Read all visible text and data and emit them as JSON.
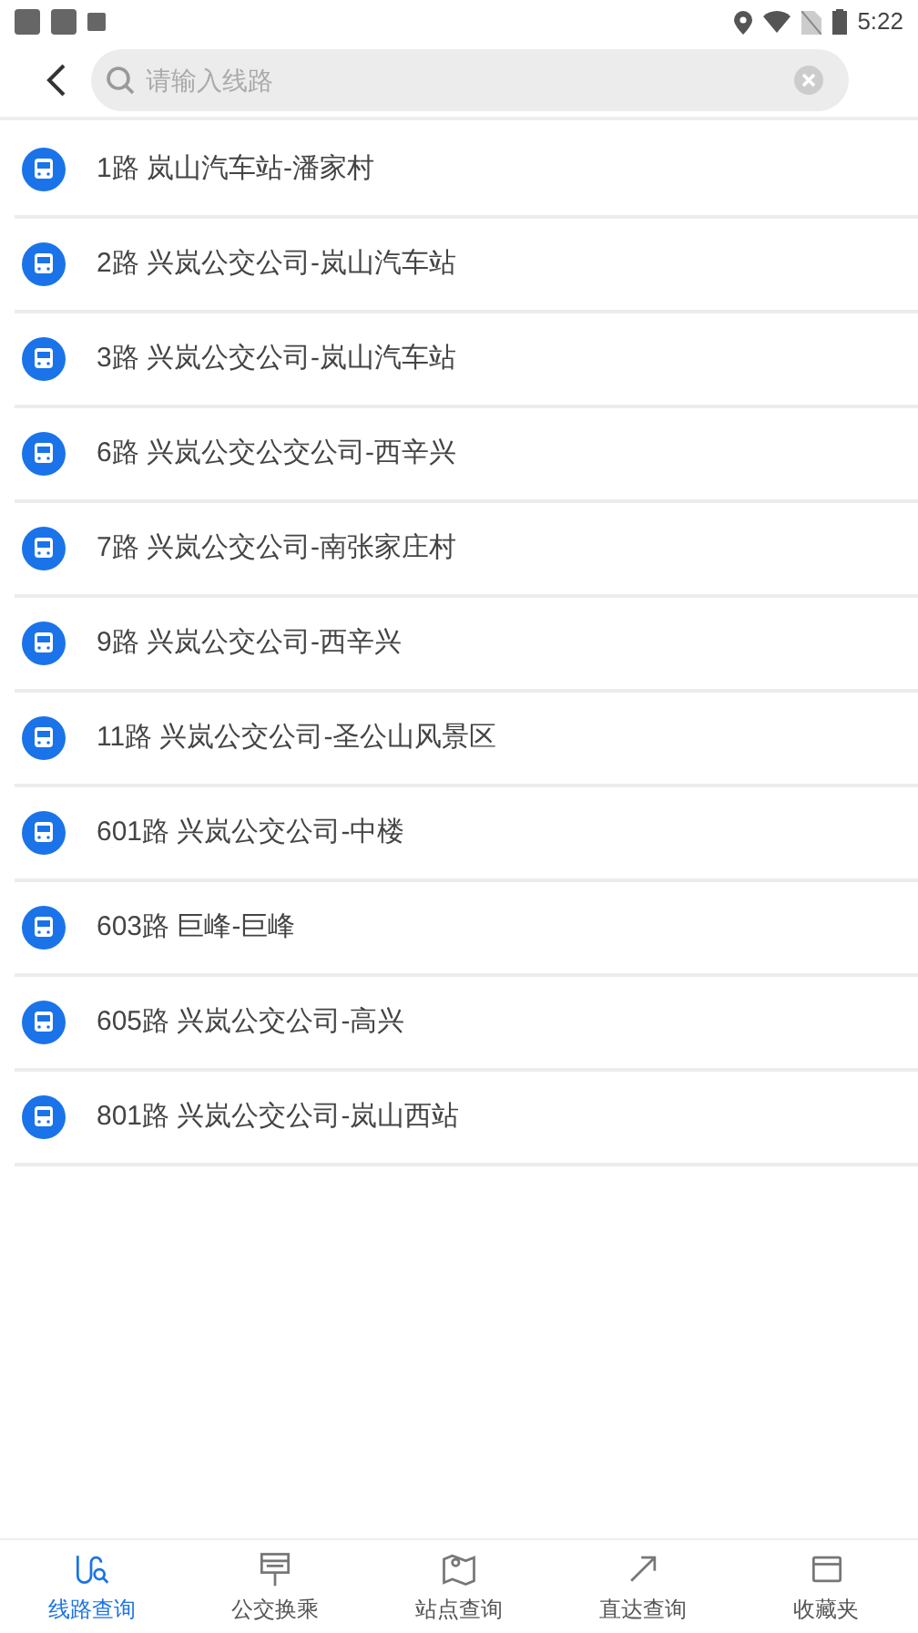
{
  "status_bar": {
    "time": "5:22"
  },
  "search": {
    "placeholder": "请输入线路"
  },
  "routes": [
    {
      "label": "1路 岚山汽车站-潘家村"
    },
    {
      "label": "2路 兴岚公交公司-岚山汽车站"
    },
    {
      "label": "3路 兴岚公交公司-岚山汽车站"
    },
    {
      "label": "6路 兴岚公交公交公司-西辛兴"
    },
    {
      "label": "7路 兴岚公交公司-南张家庄村"
    },
    {
      "label": "9路 兴岚公交公司-西辛兴"
    },
    {
      "label": "11路 兴岚公交公司-圣公山风景区"
    },
    {
      "label": "601路 兴岚公交公司-中楼"
    },
    {
      "label": "603路 巨峰-巨峰"
    },
    {
      "label": "605路 兴岚公交公司-高兴"
    },
    {
      "label": "801路 兴岚公交公司-岚山西站"
    }
  ],
  "tabs": [
    {
      "label": "线路查询",
      "kind": "route",
      "selected": true
    },
    {
      "label": "公交换乘",
      "kind": "transfer",
      "selected": false
    },
    {
      "label": "站点查询",
      "kind": "stop",
      "selected": false
    },
    {
      "label": "直达查询",
      "kind": "direct",
      "selected": false
    },
    {
      "label": "收藏夹",
      "kind": "favorites",
      "selected": false
    }
  ]
}
